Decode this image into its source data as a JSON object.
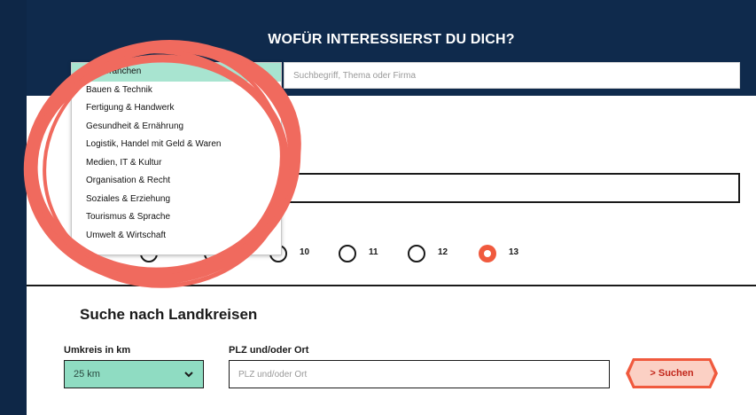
{
  "header": {
    "title": "WOFÜR INTERESSIERST DU DICH?"
  },
  "search": {
    "placeholder": "Suchbegriff, Thema oder Firma"
  },
  "branchen_dropdown": {
    "items": [
      {
        "label": "Alle Branchen",
        "selected": true
      },
      {
        "label": "Bauen & Technik",
        "selected": false
      },
      {
        "label": "Fertigung & Handwerk",
        "selected": false
      },
      {
        "label": "Gesundheit & Ernährung",
        "selected": false
      },
      {
        "label": "Logistik, Handel mit Geld & Waren",
        "selected": false
      },
      {
        "label": "Medien, IT & Kultur",
        "selected": false
      },
      {
        "label": "Organisation & Recht",
        "selected": false
      },
      {
        "label": "Soziales & Erziehung",
        "selected": false
      },
      {
        "label": "Tourismus & Sprache",
        "selected": false
      },
      {
        "label": "Umwelt & Wirtschaft",
        "selected": false
      }
    ]
  },
  "klassen": {
    "options": [
      {
        "label": "10",
        "checked": false
      },
      {
        "label": "11",
        "checked": false
      },
      {
        "label": "12",
        "checked": false
      },
      {
        "label": "13",
        "checked": true
      }
    ]
  },
  "landkreise": {
    "title": "Suche nach Landkreisen",
    "umkreis_label": "Umkreis in km",
    "umkreis_value": "25 km",
    "plz_label": "PLZ und/oder Ort",
    "plz_placeholder": "PLZ und/oder Ort",
    "submit_label": "> Suchen"
  },
  "colors": {
    "header_bg": "#0f2a4c",
    "accent": "#f05a3e",
    "select_bg": "#8fdcc2",
    "annotation": "#f06a5e"
  }
}
